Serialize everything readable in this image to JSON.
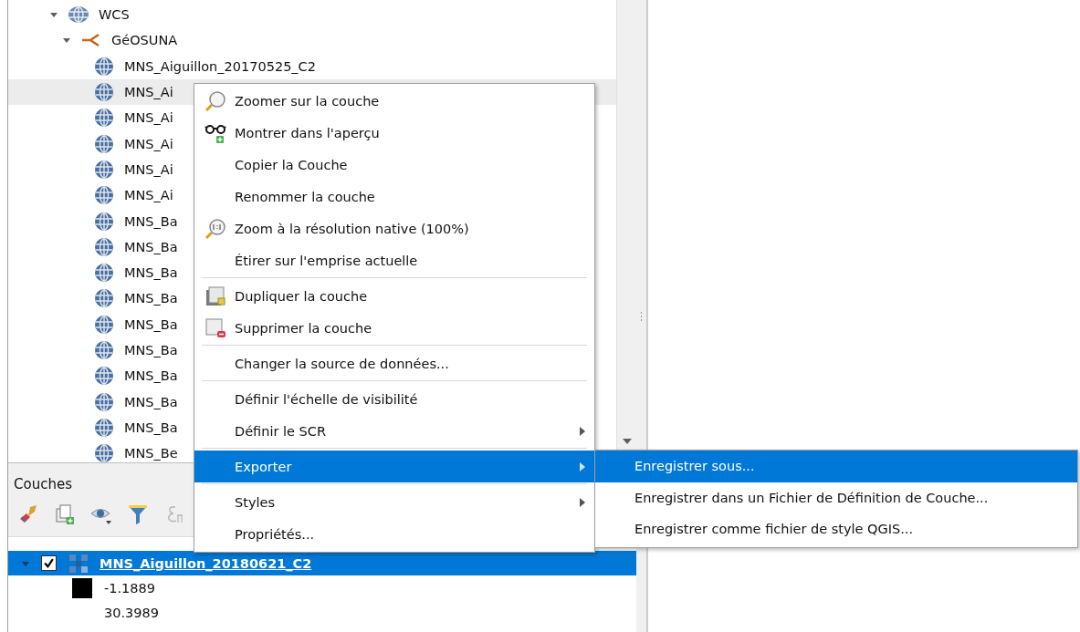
{
  "browser": {
    "tree": [
      {
        "kind": "service",
        "label": "WCS",
        "expanded": true,
        "selected": false,
        "children": [
          {
            "kind": "connection",
            "label": "GéOSUNA",
            "expanded": true,
            "selected": false,
            "children": [
              {
                "kind": "layer",
                "label": "MNS_Aiguillon_20170525_C2",
                "selected": false
              },
              {
                "kind": "layer",
                "label": "MNS_Ai",
                "selected": true
              },
              {
                "kind": "layer",
                "label": "MNS_Ai",
                "selected": false
              },
              {
                "kind": "layer",
                "label": "MNS_Ai",
                "selected": false
              },
              {
                "kind": "layer",
                "label": "MNS_Ai",
                "selected": false
              },
              {
                "kind": "layer",
                "label": "MNS_Ai",
                "selected": false
              },
              {
                "kind": "layer",
                "label": "MNS_Ba",
                "selected": false
              },
              {
                "kind": "layer",
                "label": "MNS_Ba",
                "selected": false
              },
              {
                "kind": "layer",
                "label": "MNS_Ba",
                "selected": false
              },
              {
                "kind": "layer",
                "label": "MNS_Ba",
                "selected": false
              },
              {
                "kind": "layer",
                "label": "MNS_Ba",
                "selected": false
              },
              {
                "kind": "layer",
                "label": "MNS_Ba",
                "selected": false
              },
              {
                "kind": "layer",
                "label": "MNS_Ba",
                "selected": false
              },
              {
                "kind": "layer",
                "label": "MNS_Ba",
                "selected": false
              },
              {
                "kind": "layer",
                "label": "MNS_Ba",
                "selected": false
              },
              {
                "kind": "layer",
                "label": "MNS_Be",
                "selected": false
              }
            ]
          }
        ]
      }
    ]
  },
  "layers_panel": {
    "title": "Couches",
    "toolbar": [
      {
        "kind": "style",
        "disabled": false
      },
      {
        "kind": "add-group",
        "disabled": false
      },
      {
        "kind": "visibility",
        "disabled": false
      },
      {
        "kind": "filter",
        "disabled": false
      },
      {
        "kind": "expression",
        "disabled": true
      }
    ],
    "layers": [
      {
        "label": "MNS_Aiguillon_20180621_C2",
        "expanded": true,
        "checked": true,
        "selected": true,
        "legend": [
          {
            "kind": "swatch",
            "label": "-1.1889"
          },
          {
            "kind": "value",
            "label": "30.3989"
          }
        ]
      }
    ]
  },
  "context_menu": {
    "items": [
      {
        "kind": "magnifier",
        "label": "Zoomer sur la couche",
        "submenu": false,
        "selected": false
      },
      {
        "kind": "glasses",
        "label": "Montrer dans l'aperçu",
        "submenu": false,
        "selected": false
      },
      {
        "kind": "plain",
        "label": "Copier la Couche",
        "submenu": false,
        "selected": false
      },
      {
        "kind": "plain",
        "label": "Renommer la couche",
        "submenu": false,
        "selected": false
      },
      {
        "kind": "magnifier-native",
        "label": "Zoom à la résolution native (100%)",
        "submenu": false,
        "selected": false
      },
      {
        "kind": "plain",
        "label": "Étirer sur l'emprise actuelle",
        "submenu": false,
        "selected": false
      },
      {
        "kind": "separator"
      },
      {
        "kind": "duplicate",
        "label": "Dupliquer la couche",
        "submenu": false,
        "selected": false
      },
      {
        "kind": "remove",
        "label": "Supprimer la couche",
        "submenu": false,
        "selected": false
      },
      {
        "kind": "separator"
      },
      {
        "kind": "plain",
        "label": "Changer la source de données...",
        "submenu": false,
        "selected": false
      },
      {
        "kind": "separator"
      },
      {
        "kind": "plain",
        "label": "Définir l'échelle de visibilité",
        "submenu": false,
        "selected": false
      },
      {
        "kind": "plain",
        "label": "Définir le SCR",
        "submenu": true,
        "selected": false
      },
      {
        "kind": "separator"
      },
      {
        "kind": "plain",
        "label": "Exporter",
        "submenu": true,
        "selected": true
      },
      {
        "kind": "separator"
      },
      {
        "kind": "plain",
        "label": "Styles",
        "submenu": true,
        "selected": false
      },
      {
        "kind": "plain",
        "label": "Propriétés...",
        "submenu": false,
        "selected": false
      }
    ]
  },
  "submenu": {
    "items": [
      {
        "label": "Enregistrer sous...",
        "selected": true
      },
      {
        "label": "Enregistrer dans un Fichier de Définition de Couche...",
        "selected": false
      },
      {
        "label": "Enregistrer comme fichier de style QGIS...",
        "selected": false
      }
    ]
  }
}
